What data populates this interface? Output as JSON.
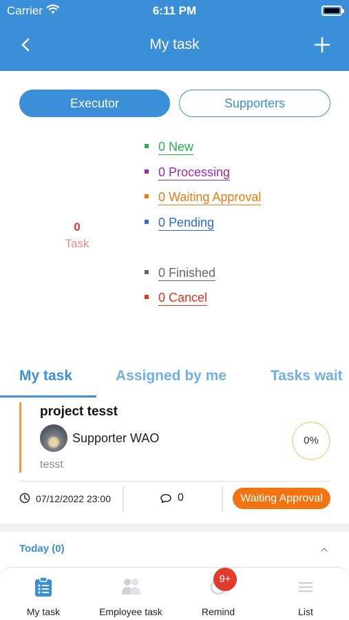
{
  "status_bar": {
    "carrier": "Carrier",
    "time": "6:11 PM"
  },
  "header": {
    "title": "My task",
    "back_icon": "chevron-left-icon",
    "add_icon": "plus-icon",
    "background_color": "#3a8fd8"
  },
  "role_toggle": {
    "executor_label": "Executor",
    "supporters_label": "Supporters",
    "selected": "Executor"
  },
  "summary": {
    "total_count": "0",
    "total_label": "Task",
    "stats": [
      {
        "label": "0 New",
        "color": "#24b34b"
      },
      {
        "label": "0 Processing",
        "color": "#9b2aa6"
      },
      {
        "label": "0 Waiting Approval",
        "color": "#f07a14"
      },
      {
        "label": "0 Pending",
        "color": "#2d69d6"
      },
      {
        "label": "0 Finished",
        "color": "#666666"
      },
      {
        "label": "0 Cancel",
        "color": "#e5321f"
      }
    ]
  },
  "tabs": [
    {
      "label": "My task",
      "active": true
    },
    {
      "label": "Assigned by me",
      "active": false
    },
    {
      "label": "Tasks wait",
      "active": false
    }
  ],
  "task": {
    "title": "project tesst",
    "supporter": "Supporter WAO",
    "description": "tesst",
    "progress": "0%",
    "date": "07/12/2022 23:00",
    "comments": "0",
    "status": "Waiting Approval",
    "status_color": "#f27410"
  },
  "section": {
    "today_label": "Today (0)"
  },
  "bottom_nav": {
    "items": [
      {
        "label": "My task",
        "icon": "clipboard-list-icon",
        "active": true
      },
      {
        "label": "Employee task",
        "icon": "users-icon",
        "active": false
      },
      {
        "label": "Remind",
        "icon": "bell-icon",
        "active": false
      },
      {
        "label": "List",
        "icon": "list-icon",
        "active": false
      }
    ],
    "remind_badge": "9+"
  }
}
